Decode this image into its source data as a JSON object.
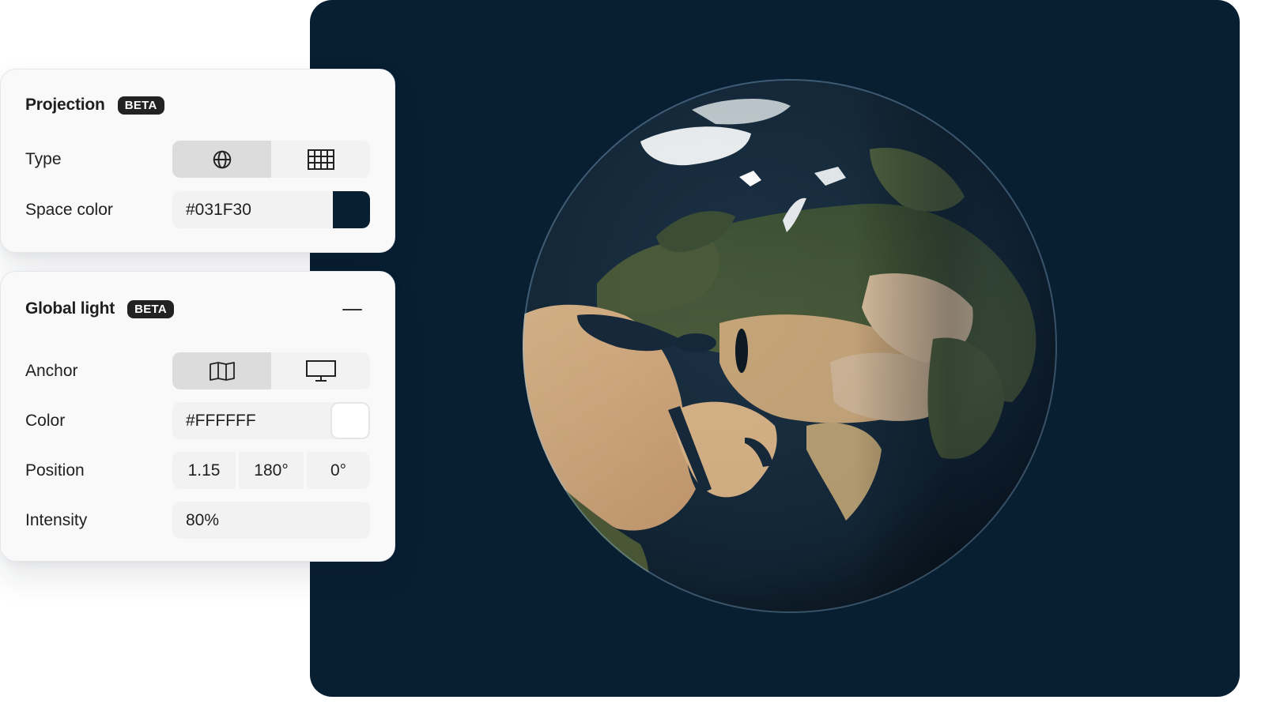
{
  "projection_panel": {
    "title": "Projection",
    "badge": "BETA",
    "type": {
      "label": "Type",
      "options": [
        {
          "icon": "globe-icon",
          "active": true
        },
        {
          "icon": "grid-icon",
          "active": false
        }
      ]
    },
    "space_color": {
      "label": "Space color",
      "value": "#031F30",
      "swatch": "#081e31"
    }
  },
  "light_panel": {
    "title": "Global light",
    "badge": "BETA",
    "collapse_icon": "minus-icon",
    "anchor": {
      "label": "Anchor",
      "options": [
        {
          "icon": "map-icon",
          "active": true
        },
        {
          "icon": "monitor-icon",
          "active": false
        }
      ]
    },
    "color": {
      "label": "Color",
      "value": "#FFFFFF",
      "swatch": "#FFFFFF"
    },
    "position": {
      "label": "Position",
      "values": [
        "1.15",
        "180°",
        "0°"
      ]
    },
    "intensity": {
      "label": "Intensity",
      "value": "80%"
    }
  },
  "viewport": {
    "background": "#081e31",
    "content": "3D Earth globe centered on Eurasia"
  }
}
